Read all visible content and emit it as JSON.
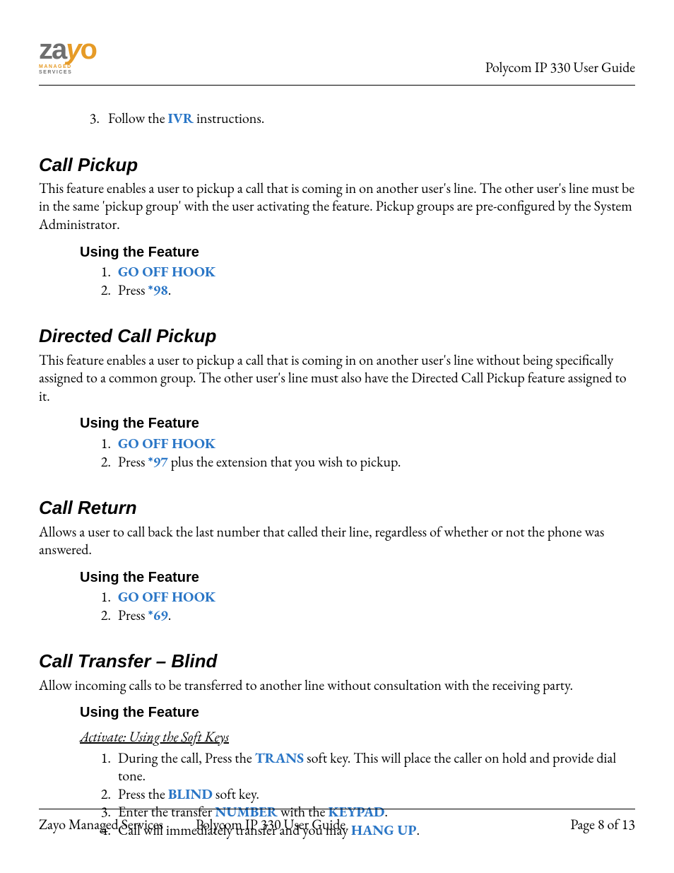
{
  "header": {
    "logo_main": "zayo",
    "logo_sub1": "MANAGED",
    "logo_sub2": "SERVICES",
    "doc_title": "Polycom IP 330 User Guide"
  },
  "top_list": {
    "item3_prefix": "Follow the ",
    "item3_hl": "IVR",
    "item3_suffix": " instructions."
  },
  "call_pickup": {
    "heading": "Call Pickup",
    "desc": "This feature enables a user to pickup a call that is coming in on another user's line.  The other user's line must be in the same 'pickup group' with the user activating the feature.  Pickup groups are pre-configured by the System Administrator.",
    "sub": "Using the Feature",
    "step1": "GO OFF HOOK",
    "step2_prefix": "Press ",
    "step2_hl": "*98",
    "step2_suffix": "."
  },
  "directed_pickup": {
    "heading": "Directed Call Pickup",
    "desc": "This feature enables a user to pickup a call that is coming in on another user's line without being specifically assigned to a common group.  The other user's line must also have the Directed Call Pickup feature assigned to it.",
    "sub": "Using the Feature",
    "step1": "GO OFF HOOK",
    "step2_prefix": "Press ",
    "step2_hl": "*97",
    "step2_suffix": " plus the extension that you wish to pickup."
  },
  "call_return": {
    "heading": "Call Return",
    "desc": "Allows a user to call back the last number that called their line, regardless of whether or not the phone was answered.",
    "sub": "Using the Feature",
    "step1": "GO OFF HOOK",
    "step2_prefix": "Press ",
    "step2_hl": "*69",
    "step2_suffix": "."
  },
  "call_transfer": {
    "heading": "Call Transfer – Blind",
    "desc": "Allow incoming calls to be transferred to another line without consultation with the receiving party.",
    "sub": "Using the Feature",
    "activate": "Activate: Using the Soft Keys",
    "s1_a": "During the call, Press the ",
    "s1_hl": "TRANS",
    "s1_b": " soft key.  This will place the caller on hold and provide dial tone.",
    "s2_a": "Press the ",
    "s2_hl": "BLIND",
    "s2_b": " soft key.",
    "s3_a": "Enter the transfer ",
    "s3_hl1": "NUMBER",
    "s3_b": " with the ",
    "s3_hl2": "KEYPAD",
    "s3_c": ".",
    "s4_a": "Call will immediately transfer and you may ",
    "s4_hl": "HANG UP",
    "s4_b": "."
  },
  "footer": {
    "left": "Zayo Managed Services",
    "center": "Polycom IP 330 User Guide",
    "right": "Page 8 of 13"
  }
}
